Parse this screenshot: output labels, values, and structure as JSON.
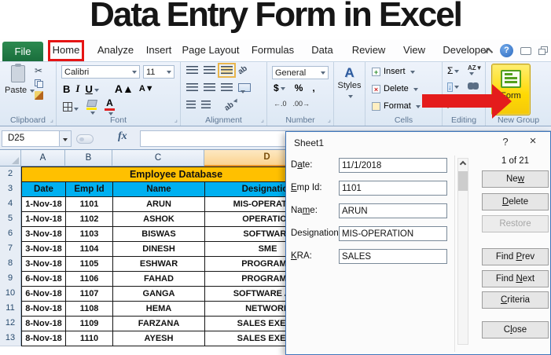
{
  "page_title": "Data Entry Form in Excel",
  "tabs": [
    "File",
    "Home",
    "Analyze",
    "Insert",
    "Page Layout",
    "Formulas",
    "Data",
    "Review",
    "View",
    "Developer"
  ],
  "window": {
    "help_glyph": "?"
  },
  "ribbon": {
    "clipboard": {
      "paste": "Paste",
      "cut_glyph": "✂",
      "label": "Clipboard"
    },
    "font": {
      "name": "Calibri",
      "size": "11",
      "bold": "B",
      "italic": "I",
      "underline": "U",
      "grow": "A",
      "shrink": "A",
      "color_a": "A",
      "label": "Font"
    },
    "alignment": {
      "orientation_glyph": "ab",
      "label": "Alignment"
    },
    "number": {
      "format": "General",
      "currency": "$",
      "percent": "%",
      "comma": ",",
      "inc_decimal": "←.0",
      "dec_decimal": ".00→",
      "label": "Number"
    },
    "styles": {
      "icon_glyph": "A",
      "label": "Styles"
    },
    "cells": {
      "insert": "Insert",
      "delete": "Delete",
      "format": "Format",
      "insert_glyph": "+",
      "delete_glyph": "×",
      "label": "Cells"
    },
    "editing": {
      "sum_glyph": "Σ",
      "az_glyph": "AZ",
      "label": "Editing"
    },
    "new_group": {
      "button": "Form",
      "label": "New Group"
    }
  },
  "formula_bar": {
    "name_box": "D25",
    "fx": "fx"
  },
  "sheet": {
    "columns": [
      "A",
      "B",
      "C",
      "D"
    ],
    "selected_column": "D",
    "title_row_number": "2",
    "header_row_number": "3",
    "title_cell": "Employee Database",
    "headers": [
      "Date",
      "Emp Id",
      "Name",
      "Designation"
    ],
    "rows": [
      {
        "n": "4",
        "date": "1-Nov-18",
        "id": "1101",
        "name": "ARUN",
        "desig": "MIS-OPERATION"
      },
      {
        "n": "5",
        "date": "1-Nov-18",
        "id": "1102",
        "name": "ASHOK",
        "desig": "OPERATION"
      },
      {
        "n": "6",
        "date": "3-Nov-18",
        "id": "1103",
        "name": "BISWAS",
        "desig": "SOFTWARE"
      },
      {
        "n": "7",
        "date": "3-Nov-18",
        "id": "1104",
        "name": "DINESH",
        "desig": "SME"
      },
      {
        "n": "8",
        "date": "3-Nov-18",
        "id": "1105",
        "name": "ESHWAR",
        "desig": "PROGRAMM"
      },
      {
        "n": "9",
        "date": "6-Nov-18",
        "id": "1106",
        "name": "FAHAD",
        "desig": "PROGRAMM"
      },
      {
        "n": "10",
        "date": "6-Nov-18",
        "id": "1107",
        "name": "GANGA",
        "desig": "SOFTWARE ASS"
      },
      {
        "n": "11",
        "date": "8-Nov-18",
        "id": "1108",
        "name": "HEMA",
        "desig": "NETWORK"
      },
      {
        "n": "12",
        "date": "8-Nov-18",
        "id": "1109",
        "name": "FARZANA",
        "desig": "SALES EXECU"
      },
      {
        "n": "13",
        "date": "8-Nov-18",
        "id": "1110",
        "name": "AYESH",
        "desig": "SALES EXECU"
      }
    ]
  },
  "dialog": {
    "title": "Sheet1",
    "help_glyph": "?",
    "close_glyph": "×",
    "record": "1 of 21",
    "fields": [
      {
        "pre": "D",
        "key": "a",
        "post": "te:",
        "value": "11/1/2018"
      },
      {
        "pre": "",
        "key": "E",
        "post": "mp Id:",
        "value": "1101"
      },
      {
        "pre": "Na",
        "key": "m",
        "post": "e:",
        "value": "ARUN"
      },
      {
        "pre": "Desi",
        "key": "g",
        "post": "nation:",
        "value": "MIS-OPERATION"
      },
      {
        "pre": "",
        "key": "K",
        "post": "RA:",
        "value": "SALES"
      }
    ],
    "buttons": [
      {
        "pre": "Ne",
        "key": "w",
        "post": ""
      },
      {
        "pre": "",
        "key": "D",
        "post": "elete"
      },
      {
        "pre": "Restore",
        "key": "",
        "post": ""
      },
      {
        "pre": "Find ",
        "key": "P",
        "post": "rev"
      },
      {
        "pre": "Find ",
        "key": "N",
        "post": "ext"
      },
      {
        "pre": "",
        "key": "C",
        "post": "riteria"
      },
      {
        "pre": "C",
        "key": "l",
        "post": "ose"
      }
    ]
  },
  "colors": {
    "title_row": "#FFC000",
    "header_row": "#00B0F0",
    "form_button": "#FFD903",
    "file_tab": "#1E7A43",
    "annotation_red": "#E51414",
    "selected_column": "#FBD38F"
  }
}
